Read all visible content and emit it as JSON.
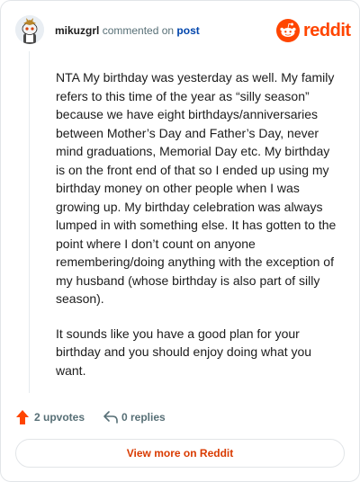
{
  "header": {
    "username": "mikuzgrl",
    "action_text": "commented on",
    "post_link": "post",
    "brand": "reddit"
  },
  "comment": {
    "paragraphs": [
      "NTA My birthday was yesterday as well. My family refers to this time of the year as “silly season” because we have eight birthdays/anniversaries between Mother’s Day and Father’s Day, never mind graduations, Memorial Day etc. My birthday is on the front end of that so I ended up using my birthday money on other people when I was growing up. My birthday celebration was always lumped in with something else. It has gotten to the point where I don’t count on anyone remembering/doing anything with the exception of my husband (whose birthday is also part of silly season).",
      "It sounds like you have a good plan for your birthday and you should enjoy doing what you want."
    ]
  },
  "actions": {
    "upvotes": "2 upvotes",
    "replies": "0 replies"
  },
  "footer": {
    "view_more": "View more on Reddit"
  },
  "colors": {
    "brand": "#ff4500",
    "link": "#0045ac",
    "view_more_text": "#d93a00"
  },
  "icons": {
    "avatar": "snoo-avatar",
    "brand": "reddit-logo",
    "upvote": "upvote-arrow-icon",
    "reply": "reply-icon"
  }
}
